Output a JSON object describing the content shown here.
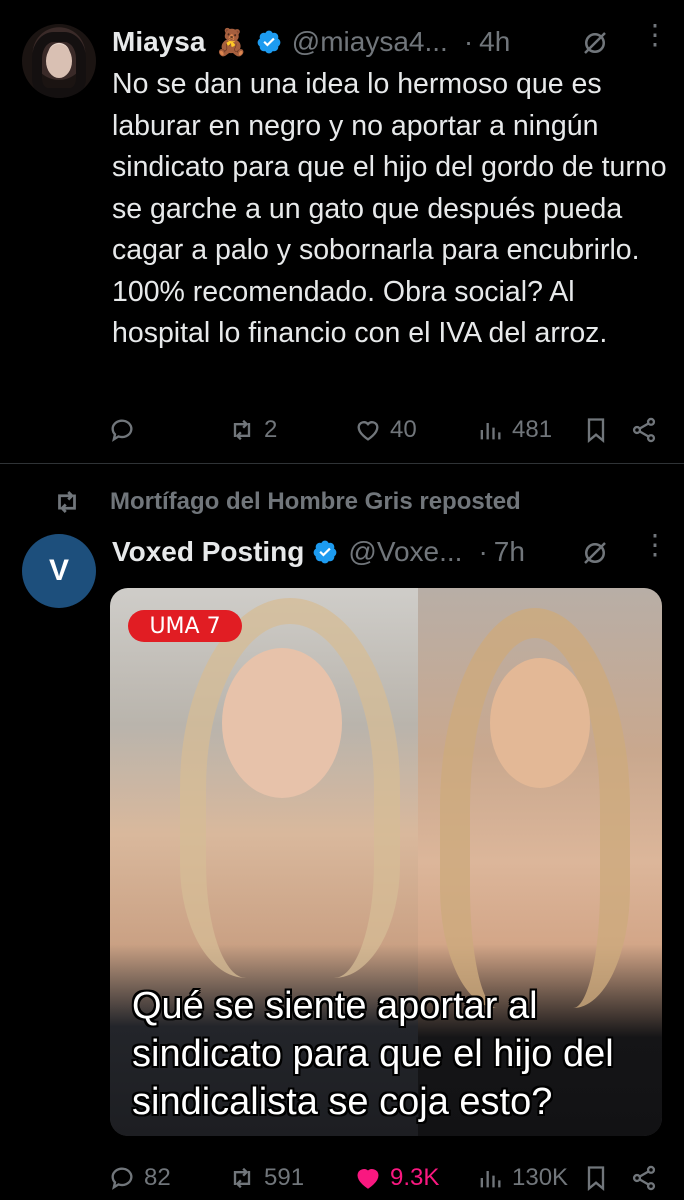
{
  "tweets": [
    {
      "author_name": "Miaysa",
      "author_emoji": "🧸",
      "handle": "@miaysa4...",
      "dot": "·",
      "time": "4h",
      "text": "No se dan una idea lo hermoso que es laburar en negro y no aportar a ningún sindicato para que el hijo del gordo de turno se garche a un gato que después pueda cagar a palo y sobornarla para encubrirlo. 100% recomendado. Obra social? Al hospital lo financio con el IVA del arroz.",
      "replies": "",
      "reposts": "2",
      "likes": "40",
      "views": "481",
      "liked": false
    },
    {
      "repost_context": "Mortífago del Hombre Gris reposted",
      "avatar_letter": "V",
      "author_name": "Voxed Posting",
      "handle": "@Voxe...",
      "dot": "·",
      "time": "7h",
      "media_badge": "UMA   7",
      "media_caption": "Qué se siente aportar al sindicato para que el hijo del sindicalista se coja esto?",
      "replies": "82",
      "reposts": "591",
      "likes": "9.3K",
      "views": "130K",
      "liked": true
    }
  ],
  "colors": {
    "background": "#000000",
    "text": "#e7e9ea",
    "muted": "#71767b",
    "verified": "#1d9bf0",
    "like_active": "#f91880",
    "badge_red": "#e11d23"
  },
  "icons": [
    "verified-icon",
    "grok-icon",
    "more-icon",
    "reply-icon",
    "repost-icon",
    "like-icon",
    "views-icon",
    "bookmark-icon",
    "share-icon"
  ]
}
